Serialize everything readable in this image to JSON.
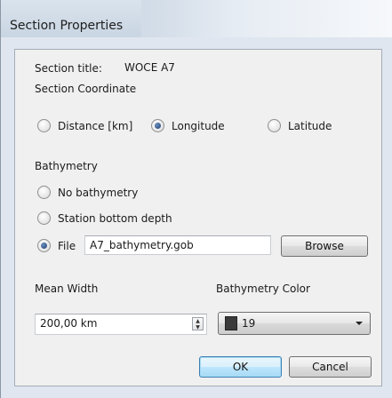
{
  "window": {
    "title": "Section Properties"
  },
  "section_title": {
    "label": "Section title:",
    "value": "WOCE A7"
  },
  "coordinate": {
    "heading": "Section Coordinate",
    "options": [
      {
        "label": "Distance [km]",
        "selected": false
      },
      {
        "label": "Longitude",
        "selected": true
      },
      {
        "label": "Latitude",
        "selected": false
      }
    ]
  },
  "bathymetry": {
    "heading": "Bathymetry",
    "options": [
      {
        "label": "No bathymetry",
        "selected": false
      },
      {
        "label": "Station bottom depth",
        "selected": false
      },
      {
        "label": "File",
        "selected": true
      }
    ],
    "file_value": "A7_bathymetry.gob",
    "browse_label": "Browse"
  },
  "mean_width": {
    "label": "Mean Width",
    "value": "200,00 km"
  },
  "bathymetry_color": {
    "label": "Bathymetry Color",
    "value": "19",
    "swatch_color": "#3b3b3b"
  },
  "buttons": {
    "ok": "OK",
    "cancel": "Cancel"
  }
}
